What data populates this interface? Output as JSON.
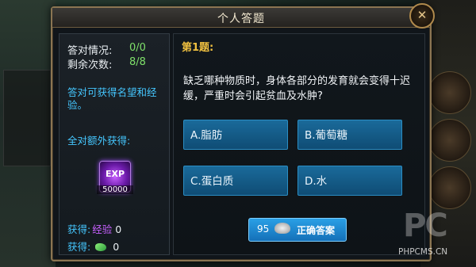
{
  "dialog": {
    "title": "个人答题",
    "close_glyph": "✕"
  },
  "left_panel": {
    "correct_label": "答对情况:",
    "correct_value": "0/0",
    "remaining_label": "剩余次数:",
    "remaining_value": "8/8",
    "info_text": "答对可获得名望和经验。",
    "extra_label": "全对额外获得:",
    "reward_icon_label": "EXP",
    "reward_amount": "50000",
    "gain_exp_label": "获得:",
    "gain_exp_sub": "经验",
    "gain_exp_value": "0",
    "gain_jade_label": "获得:",
    "gain_jade_value": "0"
  },
  "question": {
    "number": "第1题:",
    "text": "缺乏哪种物质时，身体各部分的发育就会变得十迟缓，严重时会引起贫血及水肿?",
    "options": [
      {
        "label": "A.脂肪"
      },
      {
        "label": "B.葡萄糖"
      },
      {
        "label": "C.蛋白质"
      },
      {
        "label": "D.水"
      }
    ]
  },
  "answer_button": {
    "cost": "95",
    "label": "正确答案"
  },
  "watermark": {
    "logo": "PC",
    "site": "PHPCMS.CN"
  },
  "colors": {
    "frame": "#8b7552",
    "option_bg": "#1a6a9a",
    "highlight_blue": "#45c7ff",
    "question_num": "#f0c040",
    "count_green": "#7ee06a"
  }
}
